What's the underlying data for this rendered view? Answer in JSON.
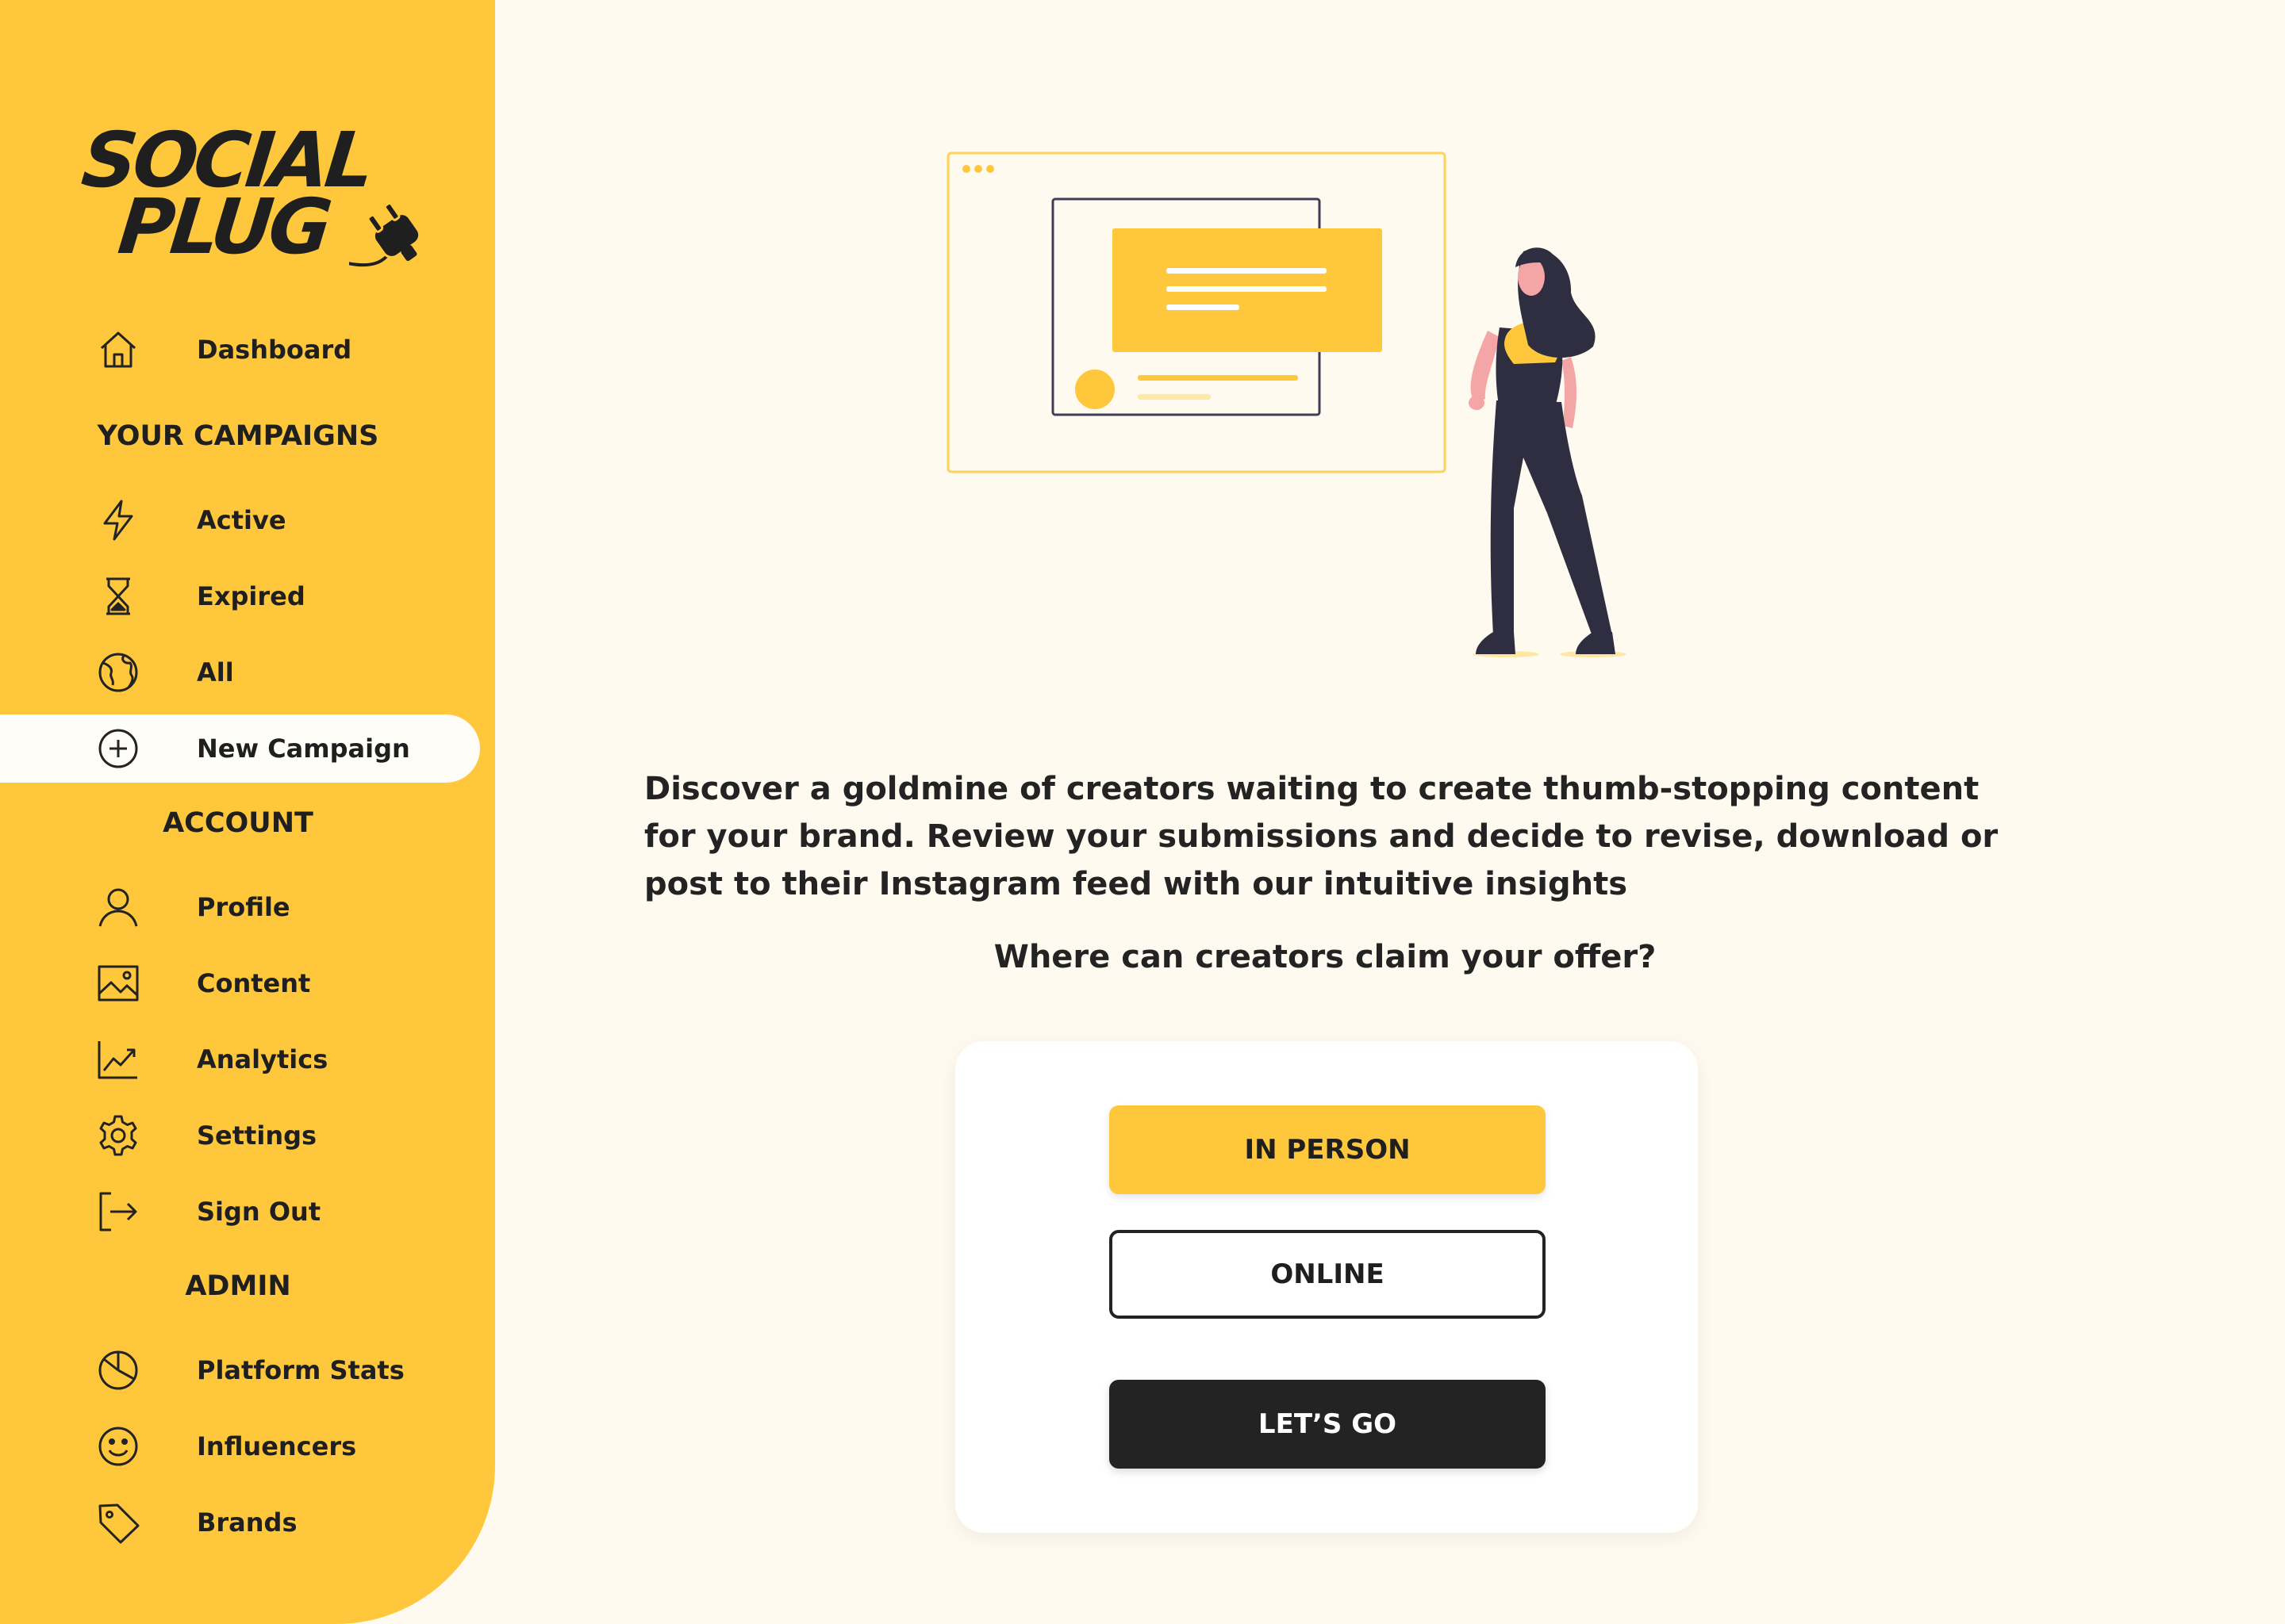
{
  "brand": {
    "logo_line1": "SOCIAL",
    "logo_line2": "PLUG",
    "colors": {
      "accent": "#FFC73C",
      "dark": "#232323",
      "background": "#FFFAF0",
      "card": "#FFFFFF",
      "skin": "#F4A5A5"
    }
  },
  "sidebar": {
    "dashboard": {
      "label": "Dashboard",
      "icon": "home-icon"
    },
    "sections": {
      "campaigns": "YOUR CAMPAIGNS",
      "account": "ACCOUNT",
      "admin": "ADMIN"
    },
    "campaign_items": [
      {
        "label": "Active",
        "icon": "lightning-icon"
      },
      {
        "label": "Expired",
        "icon": "hourglass-icon"
      },
      {
        "label": "All",
        "icon": "globe-icon"
      },
      {
        "label": "New Campaign",
        "icon": "plus-circle-icon",
        "selected": true
      }
    ],
    "account_items": [
      {
        "label": "Profile",
        "icon": "user-icon"
      },
      {
        "label": "Content",
        "icon": "image-icon"
      },
      {
        "label": "Analytics",
        "icon": "chart-line-icon"
      },
      {
        "label": "Settings",
        "icon": "gear-icon"
      },
      {
        "label": "Sign Out",
        "icon": "sign-out-icon"
      }
    ],
    "admin_items": [
      {
        "label": "Platform Stats",
        "icon": "pie-chart-icon"
      },
      {
        "label": "Influencers",
        "icon": "smiley-icon"
      },
      {
        "label": "Brands",
        "icon": "tag-icon"
      }
    ]
  },
  "main": {
    "description": "Discover a goldmine of creators waiting to create thumb-stopping content for your brand. Review your submissions and decide to revise, download or post to their Instagram feed with our intuitive insights",
    "question": "Where can creators claim your offer?",
    "options": [
      {
        "label": "IN PERSON",
        "selected": true
      },
      {
        "label": "ONLINE",
        "selected": false
      }
    ],
    "submit_label": "LET’S GO"
  }
}
